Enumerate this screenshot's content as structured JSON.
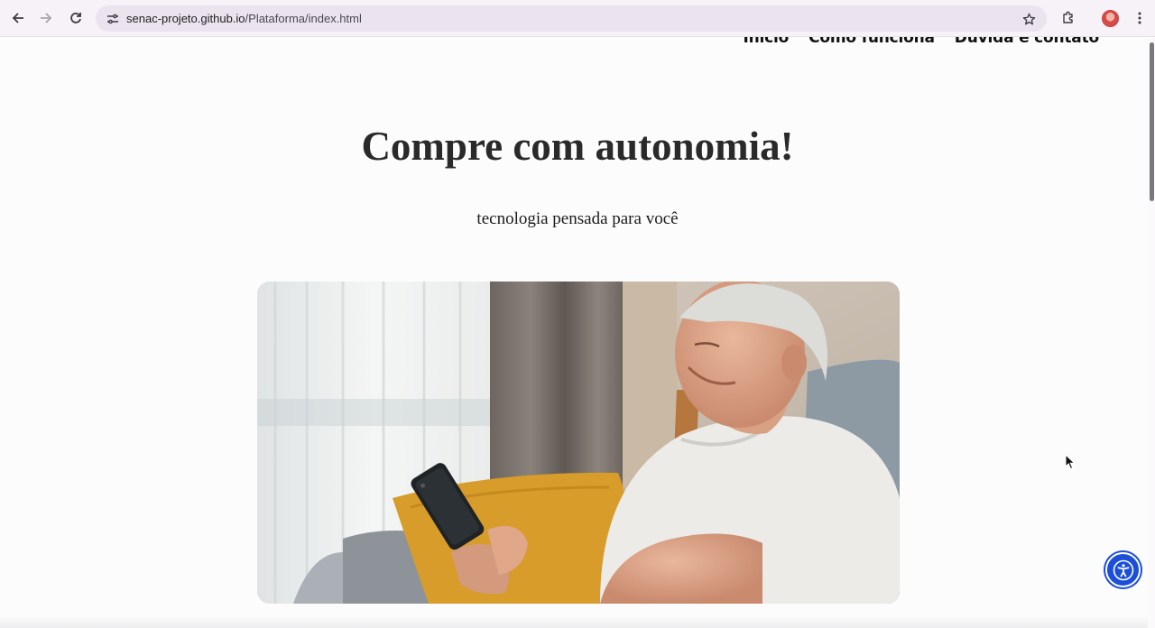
{
  "browser": {
    "url_host": "senac-projeto.github.io",
    "url_path": "/Plataforma/index.html",
    "back_icon": "arrow-left-icon",
    "forward_icon": "arrow-right-icon",
    "reload_icon": "reload-icon",
    "site_info_icon": "tune-icon",
    "bookmark_icon": "star-icon",
    "extensions_icon": "puzzle-icon",
    "menu_icon": "kebab-menu-icon"
  },
  "nav": {
    "items": [
      {
        "label": "Início"
      },
      {
        "label": "Como funciona"
      },
      {
        "label": "Dúvida e contato"
      }
    ]
  },
  "hero": {
    "title": "Compre com autonomia!",
    "subtitle": "tecnologia pensada para você"
  },
  "accessibility": {
    "icon": "accessibility-icon",
    "color": "#1c4fd8"
  }
}
